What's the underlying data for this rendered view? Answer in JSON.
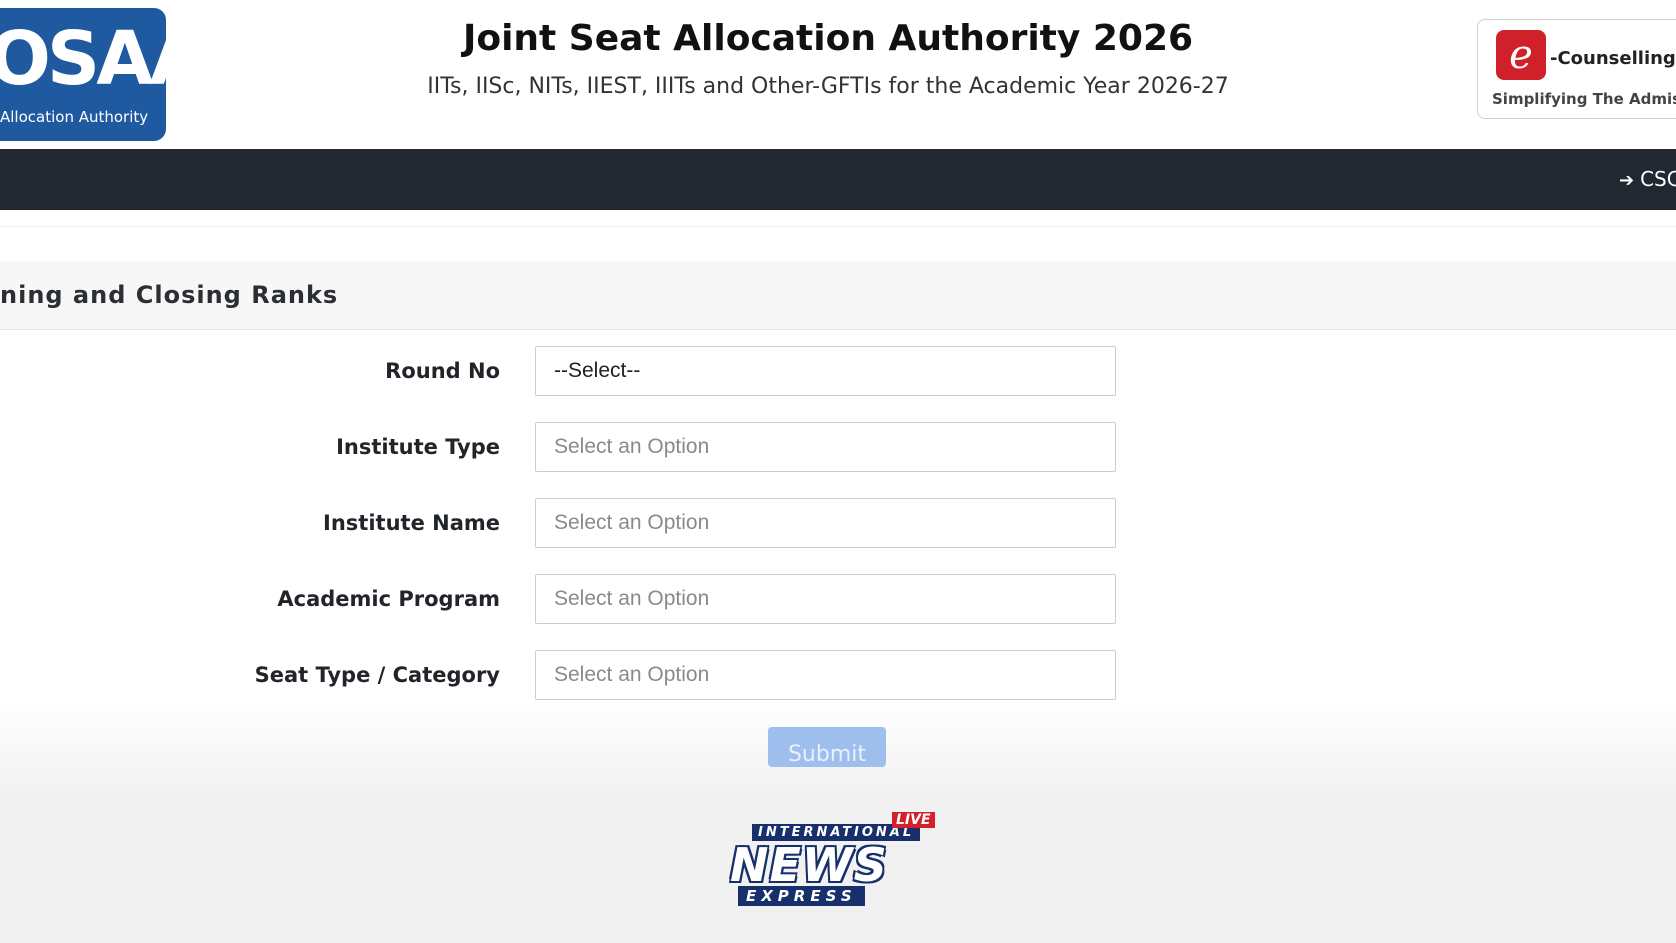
{
  "header": {
    "logo_mark": "OSAA",
    "logo_subtext": "Allocation Authority",
    "title": "Joint Seat Allocation Authority 2026",
    "subtitle": "IITs, IISc, NITs, IIEST, IIITs and Other-GFTIs for the Academic Year 2026-27",
    "ecounselling": {
      "label": "-Counselling Se",
      "tagline": "Simplifying The Admission"
    }
  },
  "navbar": {
    "link_label": "CSC",
    "link_icon": "sign-in-icon"
  },
  "card": {
    "title": "ning and Closing Ranks"
  },
  "form": {
    "fields": [
      {
        "label": "Round No",
        "value": "--Select--",
        "placeholder": ""
      },
      {
        "label": "Institute Type",
        "value": "",
        "placeholder": "Select an Option"
      },
      {
        "label": "Institute Name",
        "value": "",
        "placeholder": "Select an Option"
      },
      {
        "label": "Academic Program",
        "value": "",
        "placeholder": "Select an Option"
      },
      {
        "label": "Seat Type / Category",
        "value": "",
        "placeholder": "Select an Option"
      }
    ],
    "submit_label": "Submit"
  },
  "watermark": {
    "top": "INTERNATIONAL",
    "live": "LIVE",
    "main": "NEWS",
    "bottom": "EXPRESS"
  },
  "colors": {
    "navbar": "#222831",
    "logo_blue": "#1f5aa0",
    "submit": "#8fb6ec",
    "brand_red": "#d0202a"
  }
}
